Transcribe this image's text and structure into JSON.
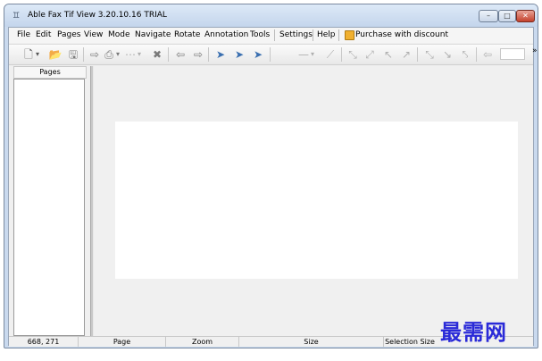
{
  "window": {
    "title": "Able Fax Tif View 3.20.10.16 TRIAL",
    "controls": {
      "minimize": "–",
      "maximize": "□",
      "close": "✕"
    }
  },
  "menu": {
    "items": [
      "File",
      "Edit",
      "Pages",
      "View",
      "Mode",
      "Navigate",
      "Rotate",
      "Annotation",
      "Tools",
      "Settings",
      "Help"
    ],
    "promo": "Purchase with discount"
  },
  "toolbar": {
    "icons": {
      "new": "🗋",
      "new_dropdown": "▾",
      "open": "📂",
      "save": "🖫",
      "export": "⇨",
      "scan": "⎙",
      "scan_dropdown": "▾",
      "print_disabled": "⋯",
      "print_dropdown": "▾",
      "delete": "✖",
      "prev": "⇦",
      "next": "⇨",
      "rotate_a": "➤",
      "rotate_b": "➤",
      "rotate_c": "➤",
      "pen_disabled": "—",
      "pen_dropdown": "▾",
      "line": "⟋",
      "tool1": "⤡",
      "tool2": "⤢",
      "tool3": "↖",
      "tool4": "↗",
      "tool5": "⤡",
      "tool6": "↘",
      "tool7": "⤣",
      "tool8": "⇦"
    },
    "overflow": "»"
  },
  "pages_panel": {
    "header": "Pages"
  },
  "status": {
    "coords": "668, 271",
    "page": "Page",
    "zoom": "Zoom",
    "size": "Size",
    "selection": "Selection Size"
  },
  "watermark": "最需网",
  "colors": {
    "close_button": "#c4412c",
    "watermark": "#2a2ad8",
    "promo_icon": "#f0b030"
  }
}
